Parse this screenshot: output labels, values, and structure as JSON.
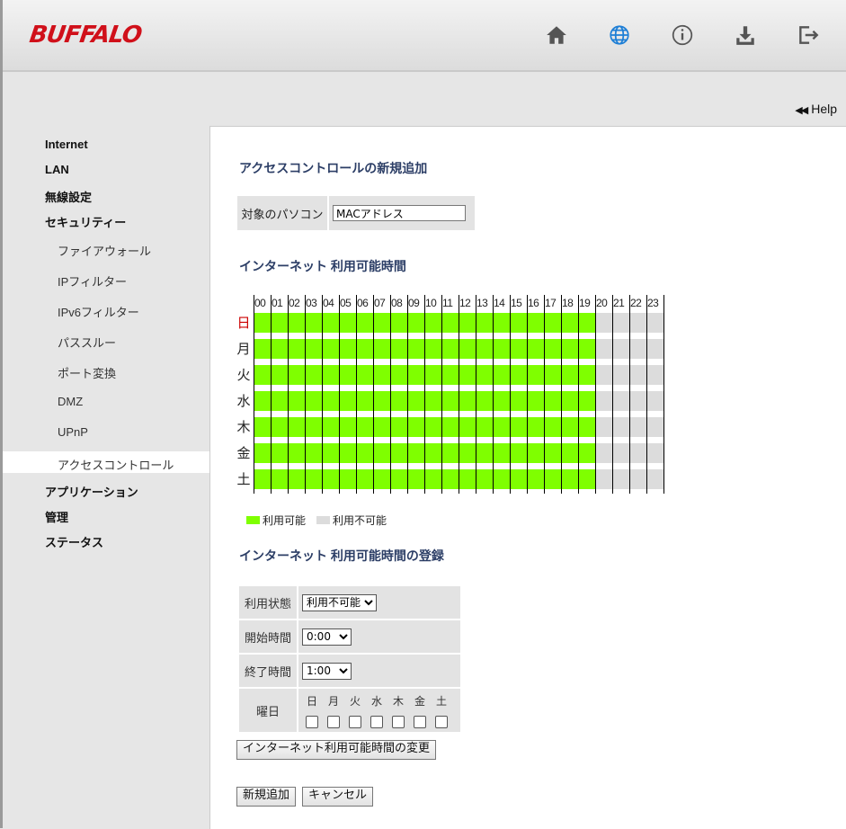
{
  "brand": {
    "logo_text": "BUFFALO",
    "logo_color": "#d0101a"
  },
  "header_icons": [
    "home-icon",
    "globe-icon",
    "info-icon",
    "download-icon",
    "logout-icon"
  ],
  "help_label": "Help",
  "sidebar": {
    "items": [
      {
        "label": "Internet",
        "level": "top"
      },
      {
        "label": "LAN",
        "level": "top"
      },
      {
        "label": "無線設定",
        "level": "top"
      },
      {
        "label": "セキュリティー",
        "level": "top"
      },
      {
        "label": "ファイアウォール",
        "level": "sub"
      },
      {
        "label": "IPフィルター",
        "level": "sub"
      },
      {
        "label": "IPv6フィルター",
        "level": "sub"
      },
      {
        "label": "パススルー",
        "level": "sub"
      },
      {
        "label": "ポート変換",
        "level": "sub"
      },
      {
        "label": "DMZ",
        "level": "sub"
      },
      {
        "label": "UPnP",
        "level": "sub"
      },
      {
        "label": "アクセスコントロール",
        "level": "sub",
        "active": true
      },
      {
        "label": "アプリケーション",
        "level": "top"
      },
      {
        "label": "管理",
        "level": "top"
      },
      {
        "label": "ステータス",
        "level": "top"
      }
    ]
  },
  "main": {
    "title": "アクセスコントロールの新規追加",
    "target_label": "対象のパソコン",
    "target_value": "MACアドレス",
    "schedule_title": "インターネット 利用可能時間",
    "hours": [
      "00",
      "01",
      "02",
      "03",
      "04",
      "05",
      "06",
      "07",
      "08",
      "09",
      "10",
      "11",
      "12",
      "13",
      "14",
      "15",
      "16",
      "17",
      "18",
      "19",
      "20",
      "21",
      "22",
      "23"
    ],
    "days": [
      "日",
      "月",
      "火",
      "水",
      "木",
      "金",
      "土"
    ],
    "available_hours_per_day": 20,
    "colors": {
      "available": "#7fff00",
      "unavailable": "#dcdcdc",
      "sunday": "#cc0000",
      "heading": "#2c3e66"
    },
    "legend": {
      "available": "利用可能",
      "unavailable": "利用不可能"
    },
    "register_title": "インターネット 利用可能時間の登録",
    "status_label": "利用状態",
    "status_value": "利用不可能",
    "start_label": "開始時間",
    "start_value": "0:00",
    "end_label": "終了時間",
    "end_value": "1:00",
    "weekday_label": "曜日",
    "weekday_options": [
      "日",
      "月",
      "火",
      "水",
      "木",
      "金",
      "土"
    ],
    "change_button": "インターネット利用可能時間の変更",
    "add_button": "新規追加",
    "cancel_button": "キャンセル"
  }
}
